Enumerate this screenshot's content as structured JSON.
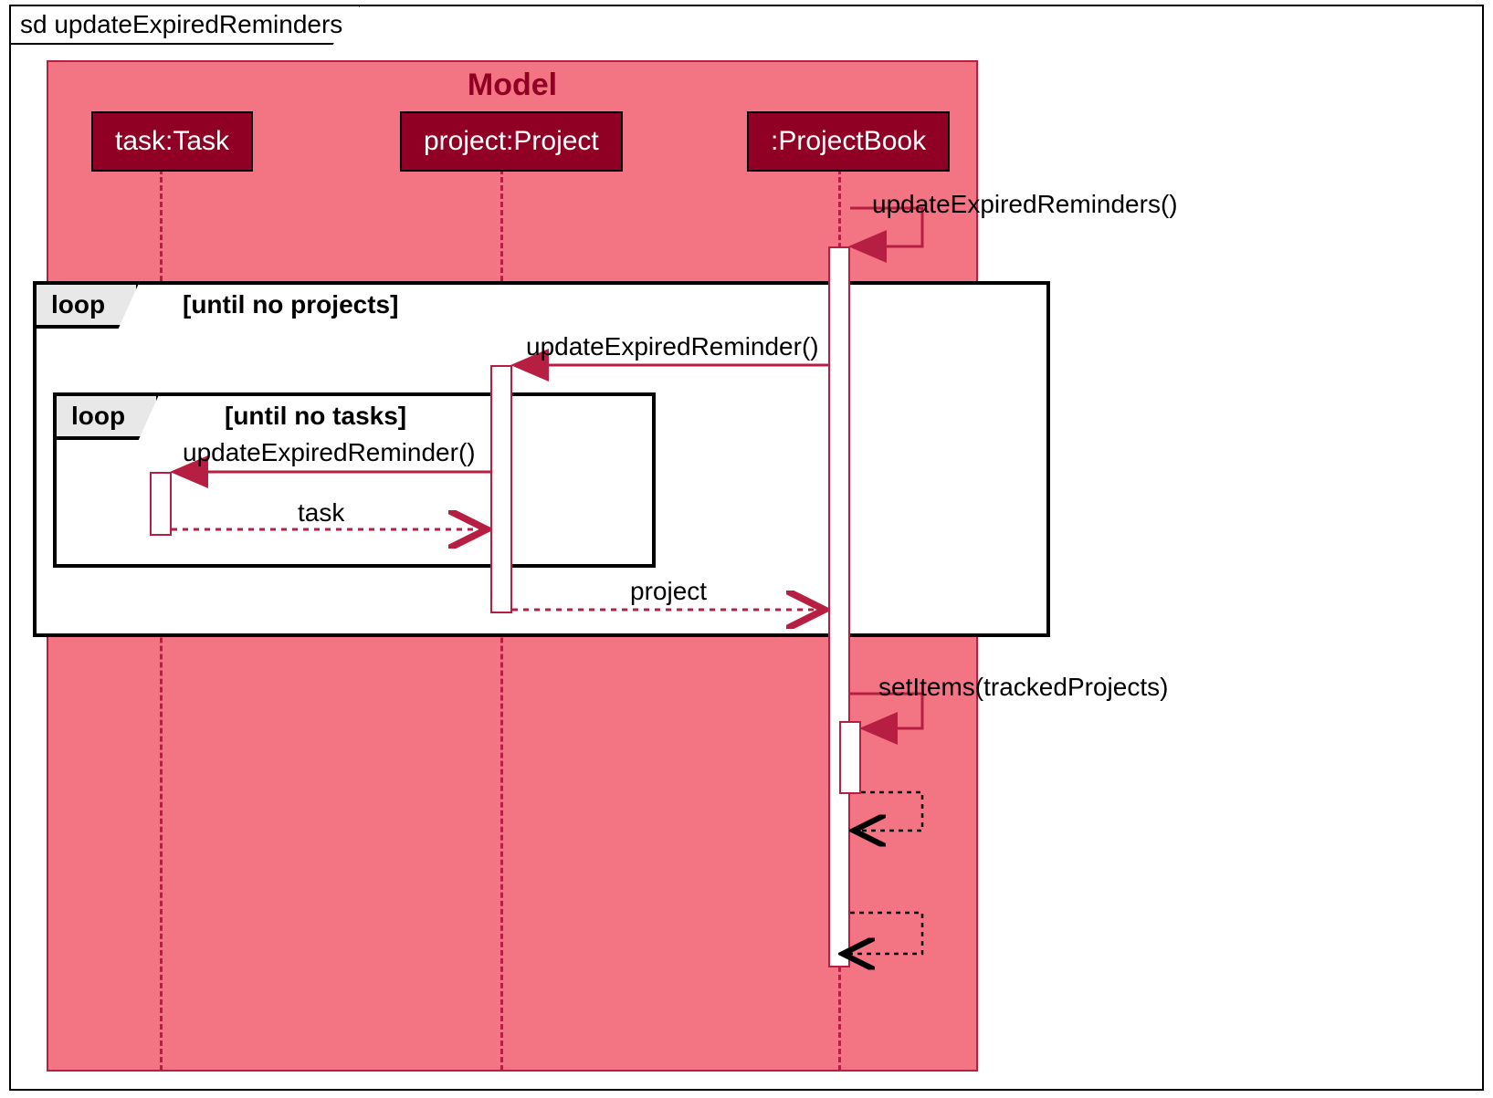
{
  "frame": {
    "title": "sd updateExpiredReminders"
  },
  "model": {
    "title": "Model"
  },
  "participants": {
    "task": "task:Task",
    "project": "project:Project",
    "projectbook": ":ProjectBook"
  },
  "loops": {
    "outer": {
      "label": "loop",
      "condition": "[until no projects]"
    },
    "inner": {
      "label": "loop",
      "condition": "[until no tasks]"
    }
  },
  "messages": {
    "m1": "updateExpiredReminders()",
    "m2": "updateExpiredReminder()",
    "m3": "updateExpiredReminder()",
    "m4": "task",
    "m5": "project",
    "m6": "setItems(trackedProjects)"
  }
}
